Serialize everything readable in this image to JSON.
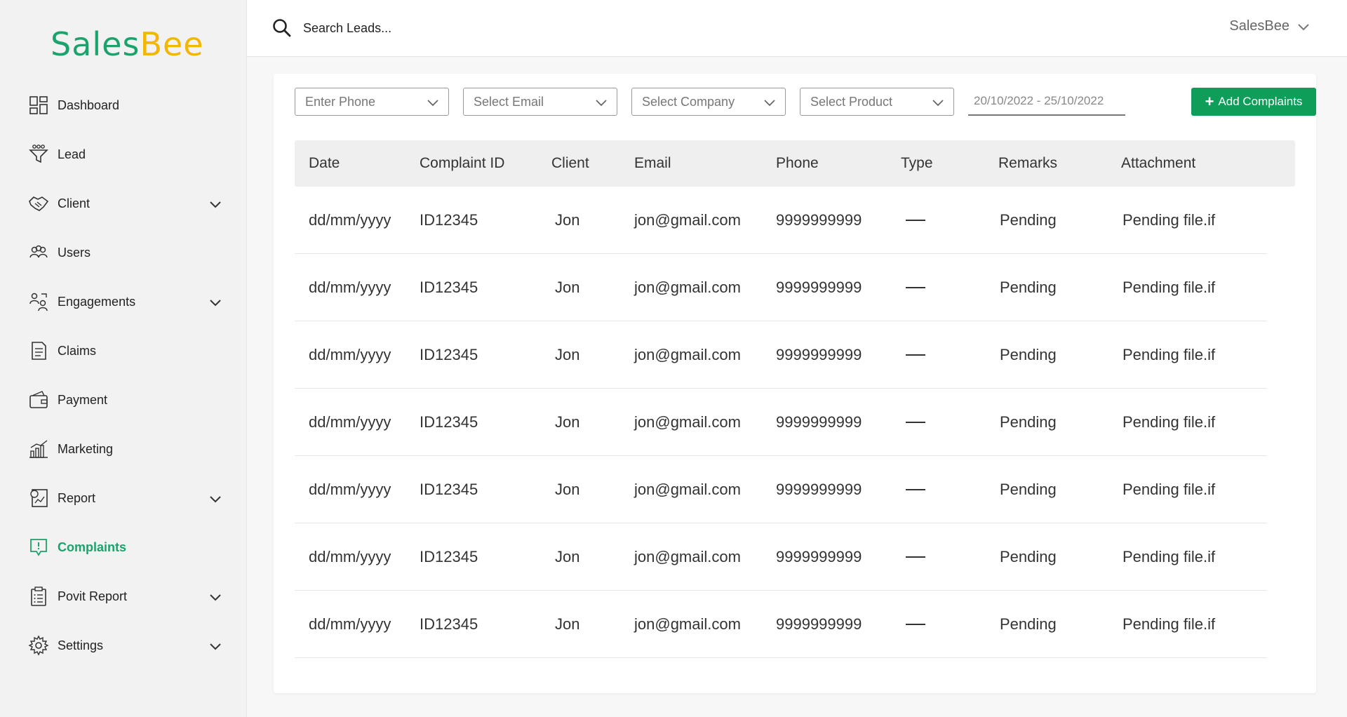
{
  "brand": {
    "sales": "Sales",
    "bee": "Bee"
  },
  "sidebar": {
    "items": [
      {
        "label": "Dashboard",
        "icon": "dashboard-icon",
        "has_submenu": false,
        "active": false
      },
      {
        "label": "Lead",
        "icon": "funnel-icon",
        "has_submenu": false,
        "active": false
      },
      {
        "label": "Client",
        "icon": "handshake-icon",
        "has_submenu": true,
        "active": false
      },
      {
        "label": "Users",
        "icon": "users-icon",
        "has_submenu": false,
        "active": false
      },
      {
        "label": "Engagements",
        "icon": "engagement-icon",
        "has_submenu": true,
        "active": false
      },
      {
        "label": "Claims",
        "icon": "document-icon",
        "has_submenu": false,
        "active": false
      },
      {
        "label": "Payment",
        "icon": "wallet-icon",
        "has_submenu": false,
        "active": false
      },
      {
        "label": "Marketing",
        "icon": "bar-chart-icon",
        "has_submenu": false,
        "active": false
      },
      {
        "label": "Report",
        "icon": "report-icon",
        "has_submenu": true,
        "active": false
      },
      {
        "label": "Complaints",
        "icon": "complaint-icon",
        "has_submenu": false,
        "active": true
      },
      {
        "label": "Povit Report",
        "icon": "clipboard-icon",
        "has_submenu": true,
        "active": false
      },
      {
        "label": "Settings",
        "icon": "gear-icon",
        "has_submenu": true,
        "active": false
      }
    ]
  },
  "header": {
    "search_placeholder": "Search Leads...",
    "user_name": "SalesBee"
  },
  "filters": {
    "phone": "Enter Phone",
    "email": "Select Email",
    "company": "Select Company",
    "product": "Select Product",
    "date_range": "20/10/2022 - 25/10/2022",
    "add_button": "Add Complaints"
  },
  "table": {
    "columns": [
      "Date",
      "Complaint ID",
      "Client",
      "Email",
      "Phone",
      "Type",
      "Remarks",
      "Attachment"
    ],
    "rows": [
      [
        "dd/mm/yyyy",
        "ID12345",
        "Jon",
        "jon@gmail.com",
        "9999999999",
        "",
        "Pending",
        "Pending file.if"
      ],
      [
        "dd/mm/yyyy",
        "ID12345",
        "Jon",
        "jon@gmail.com",
        "9999999999",
        "",
        "Pending",
        "Pending file.if"
      ],
      [
        "dd/mm/yyyy",
        "ID12345",
        "Jon",
        "jon@gmail.com",
        "9999999999",
        "",
        "Pending",
        "Pending file.if"
      ],
      [
        "dd/mm/yyyy",
        "ID12345",
        "Jon",
        "jon@gmail.com",
        "9999999999",
        "",
        "Pending",
        "Pending file.if"
      ],
      [
        "dd/mm/yyyy",
        "ID12345",
        "Jon",
        "jon@gmail.com",
        "9999999999",
        "",
        "Pending",
        "Pending file.if"
      ],
      [
        "dd/mm/yyyy",
        "ID12345",
        "Jon",
        "jon@gmail.com",
        "9999999999",
        "",
        "Pending",
        "Pending file.if"
      ],
      [
        "dd/mm/yyyy",
        "ID12345",
        "Jon",
        "jon@gmail.com",
        "9999999999",
        "",
        "Pending",
        "Pending file.if"
      ]
    ]
  },
  "colors": {
    "accent": "#1aa36a",
    "button": "#0f9d5a",
    "brand_bee": "#f2b705"
  }
}
